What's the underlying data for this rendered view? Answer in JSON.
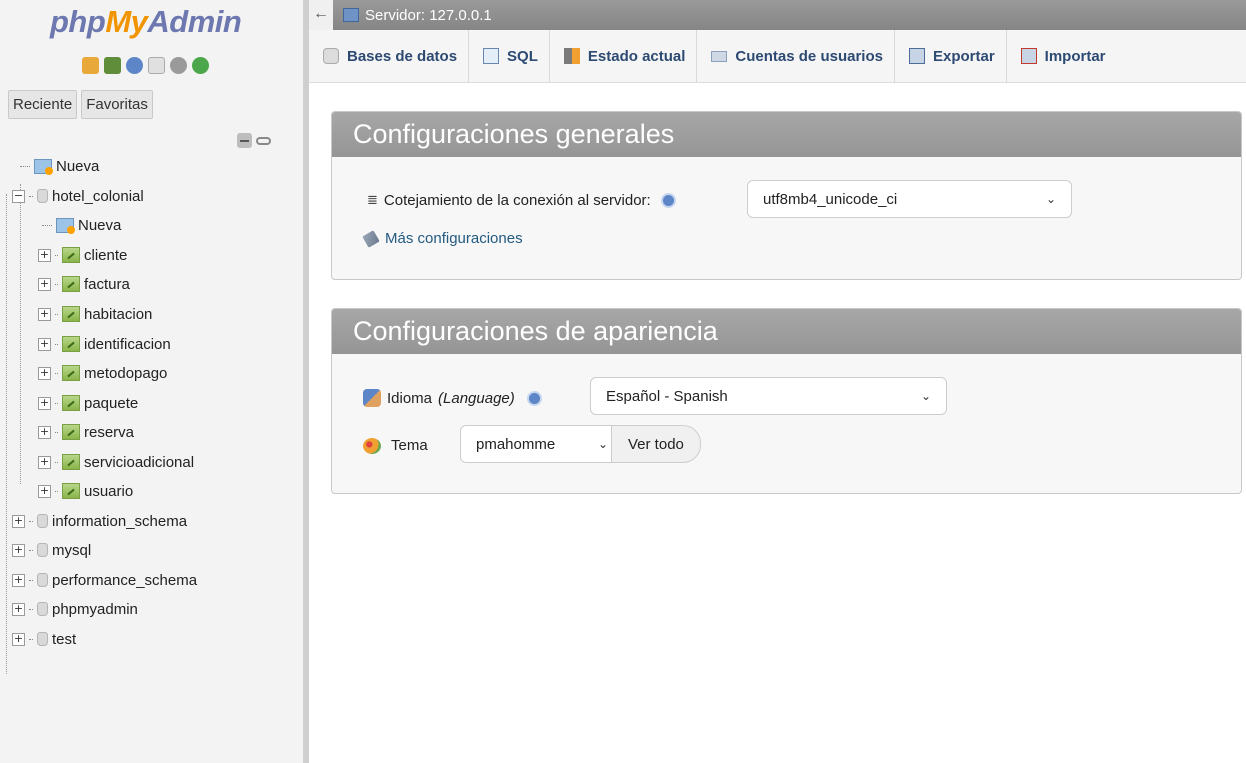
{
  "logo": {
    "php": "php",
    "my": "My",
    "admin": "Admin"
  },
  "nav": {
    "tabs": [
      "Reciente",
      "Favoritas"
    ],
    "tree": [
      {
        "label": "Nueva",
        "kind": "new"
      },
      {
        "label": "hotel_colonial",
        "kind": "db"
      },
      {
        "label": "Nueva",
        "kind": "new"
      },
      {
        "label": "cliente",
        "kind": "table"
      },
      {
        "label": "factura",
        "kind": "table"
      },
      {
        "label": "habitacion",
        "kind": "table"
      },
      {
        "label": "identificacion",
        "kind": "table"
      },
      {
        "label": "metodopago",
        "kind": "table"
      },
      {
        "label": "paquete",
        "kind": "table"
      },
      {
        "label": "reserva",
        "kind": "table"
      },
      {
        "label": "servicioadicional",
        "kind": "table"
      },
      {
        "label": "usuario",
        "kind": "table"
      },
      {
        "label": "information_schema",
        "kind": "db"
      },
      {
        "label": "mysql",
        "kind": "db"
      },
      {
        "label": "performance_schema",
        "kind": "db"
      },
      {
        "label": "phpmyadmin",
        "kind": "db"
      },
      {
        "label": "test",
        "kind": "db"
      }
    ]
  },
  "topbar": {
    "back": "←",
    "server": "Servidor: 127.0.0.1"
  },
  "menu": [
    {
      "label": "Bases de datos",
      "icon": "database-icon"
    },
    {
      "label": "SQL",
      "icon": "sql-icon"
    },
    {
      "label": "Estado actual",
      "icon": "status-icon"
    },
    {
      "label": "Cuentas de usuarios",
      "icon": "users-icon"
    },
    {
      "label": "Exportar",
      "icon": "export-icon"
    },
    {
      "label": "Importar",
      "icon": "import-icon"
    }
  ],
  "general": {
    "title": "Configuraciones generales",
    "collation_label": "Cotejamiento de la conexión al servidor:",
    "collation_value": "utf8mb4_unicode_ci",
    "more_settings": "Más configuraciones"
  },
  "appearance": {
    "title": "Configuraciones de apariencia",
    "language_label": "Idioma",
    "language_label_en": "(Language)",
    "language_value": "Español - Spanish",
    "theme_label": "Tema",
    "theme_value": "pmahomme",
    "view_all": "Ver todo"
  },
  "colors": {
    "accent_orange": "#f29400",
    "logo_blue": "#6c78af",
    "link_blue": "#235a81",
    "header_grey": "#9e9e9e"
  }
}
